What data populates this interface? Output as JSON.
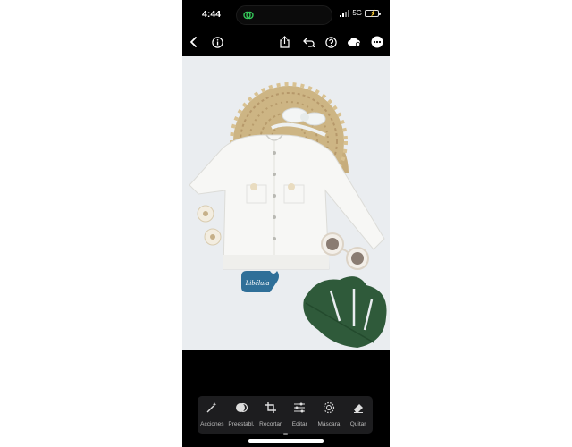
{
  "status_bar": {
    "time": "4:44",
    "network": "5G",
    "icons": [
      "dynamic-island-activity-icon",
      "signal-icon",
      "battery-charging-icon"
    ]
  },
  "top_toolbar": {
    "icons": [
      "back-chevron-icon",
      "info-icon",
      "share-icon",
      "undo-icon",
      "help-icon",
      "cloud-sync-icon",
      "more-icon"
    ]
  },
  "photo": {
    "watermark_text": "Libélula",
    "colors": {
      "background": "#e9edf0",
      "cardigan": "#f7f7f5",
      "wicker": "#c9b07f",
      "leaf": "#2f5a3a",
      "tag": "#2f6f98"
    }
  },
  "bottom_tools": {
    "items": [
      {
        "label": "Acciones",
        "icon": "magic-wand-icon"
      },
      {
        "label": "Preestabl.",
        "icon": "presets-icon"
      },
      {
        "label": "Recortar",
        "icon": "crop-icon"
      },
      {
        "label": "Editar",
        "icon": "sliders-icon"
      },
      {
        "label": "Máscara",
        "icon": "mask-icon"
      },
      {
        "label": "Quitar",
        "icon": "eraser-icon"
      }
    ]
  }
}
